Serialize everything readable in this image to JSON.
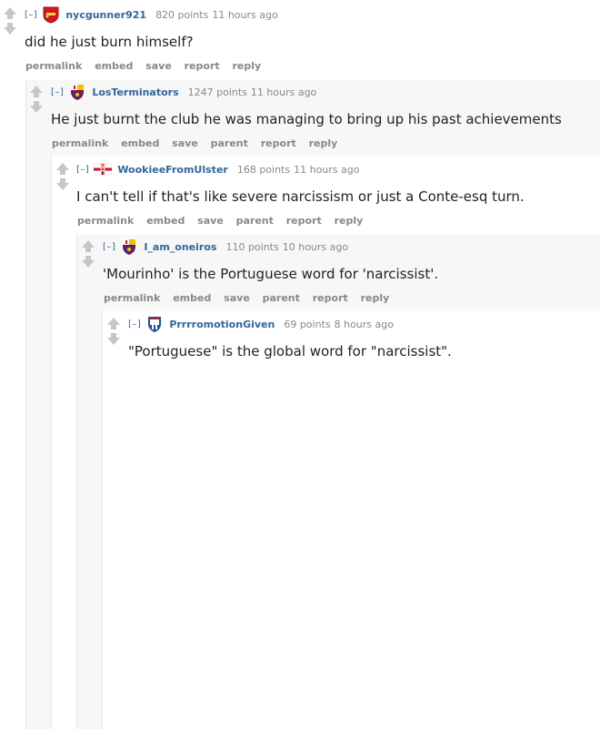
{
  "comments": [
    {
      "collapse": "[–]",
      "flair_icon": "arsenal-crest-icon",
      "author": "nycgunner921",
      "score": "820 points",
      "time": "11 hours ago",
      "body": "did he just burn himself?",
      "buttons": [
        "permalink",
        "embed",
        "save",
        "report",
        "reply"
      ]
    },
    {
      "collapse": "[–]",
      "flair_icon": "barcelona-crest-icon",
      "author": "LosTerminators",
      "score": "1247 points",
      "time": "11 hours ago",
      "body": "He just burnt the club he was managing to bring up his past achievements",
      "buttons": [
        "permalink",
        "embed",
        "save",
        "parent",
        "report",
        "reply"
      ]
    },
    {
      "collapse": "[–]",
      "flair_icon": "northern-ireland-flag-icon",
      "author": "WookieeFromUlster",
      "score": "168 points",
      "time": "11 hours ago",
      "body": "I can't tell if that's like severe narcissism or just a Conte-esq turn.",
      "buttons": [
        "permalink",
        "embed",
        "save",
        "parent",
        "report",
        "reply"
      ]
    },
    {
      "collapse": "[–]",
      "flair_icon": "barcelona-crest-icon",
      "author": "I_am_oneiros",
      "score": "110 points",
      "time": "10 hours ago",
      "body": "'Mourinho' is the Portuguese word for 'narcissist'.",
      "buttons": [
        "permalink",
        "embed",
        "save",
        "parent",
        "report",
        "reply"
      ]
    },
    {
      "collapse": "[–]",
      "flair_icon": "ipswich-crest-icon",
      "author": "PrrrromotionGiven",
      "score": "69 points",
      "time": "8 hours ago",
      "body": "\"Portuguese\" is the global word for \"narcissist\".",
      "buttons": []
    }
  ],
  "colors": {
    "author": "#336699",
    "meta": "#888888",
    "vote_arrow": "#c6c6c6",
    "nest_bg": "#f7f7f8"
  }
}
